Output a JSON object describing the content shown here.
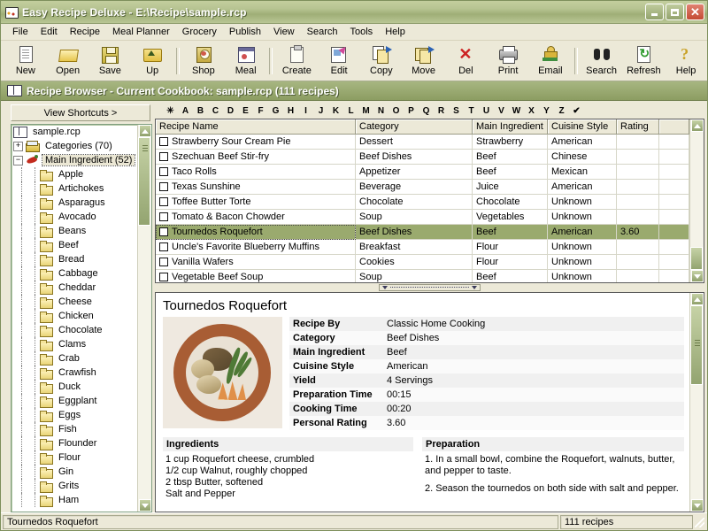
{
  "window": {
    "title": "Easy Recipe Deluxe - E:\\Recipe\\sample.rcp",
    "icon": "recipe-book-icon",
    "minimize": "_",
    "maximize": "□",
    "close": "✕"
  },
  "menu": {
    "items": [
      "File",
      "Edit",
      "Recipe",
      "Meal Planner",
      "Grocery",
      "Publish",
      "View",
      "Search",
      "Tools",
      "Help"
    ]
  },
  "toolbar": {
    "buttons": [
      {
        "label": "New",
        "icon": "new-page-icon"
      },
      {
        "label": "Open",
        "icon": "open-folder-icon"
      },
      {
        "label": "Save",
        "icon": "floppy-disk-icon"
      },
      {
        "label": "Up",
        "icon": "folder-up-icon"
      },
      {
        "label": "Shop",
        "icon": "shopping-icon"
      },
      {
        "label": "Meal",
        "icon": "meal-planner-icon"
      },
      {
        "label": "Create",
        "icon": "clipboard-new-icon"
      },
      {
        "label": "Edit",
        "icon": "edit-recipe-icon"
      },
      {
        "label": "Copy",
        "icon": "copy-icon"
      },
      {
        "label": "Move",
        "icon": "move-icon"
      },
      {
        "label": "Del",
        "icon": "delete-x-icon"
      },
      {
        "label": "Print",
        "icon": "printer-icon"
      },
      {
        "label": "Email",
        "icon": "email-icon"
      },
      {
        "label": "Search",
        "icon": "binoculars-icon"
      },
      {
        "label": "Refresh",
        "icon": "refresh-icon"
      },
      {
        "label": "Help",
        "icon": "question-mark-icon"
      }
    ]
  },
  "banner": {
    "icon": "open-book-icon",
    "text": "Recipe Browser - Current Cookbook: sample.rcp (111 recipes)"
  },
  "sidebar": {
    "shortcuts_button": "View Shortcuts >",
    "root": "sample.rcp",
    "nodes": [
      {
        "label": "Categories (70)",
        "expander": "+",
        "icon": "cards-icon",
        "level": 1,
        "selected": false
      },
      {
        "label": "Main Ingredient (52)",
        "expander": "−",
        "icon": "chili-icon",
        "level": 1,
        "selected": true
      }
    ],
    "leaves": [
      "Apple",
      "Artichokes",
      "Asparagus",
      "Avocado",
      "Beans",
      "Beef",
      "Bread",
      "Cabbage",
      "Cheddar",
      "Cheese",
      "Chicken",
      "Chocolate",
      "Clams",
      "Crab",
      "Crawfish",
      "Duck",
      "Eggplant",
      "Eggs",
      "Fish",
      "Flounder",
      "Flour",
      "Gin",
      "Grits",
      "Ham"
    ]
  },
  "alphabet_bar": {
    "items": [
      "✳",
      "A",
      "B",
      "C",
      "D",
      "E",
      "F",
      "G",
      "H",
      "I",
      "J",
      "K",
      "L",
      "M",
      "N",
      "O",
      "P",
      "Q",
      "R",
      "S",
      "T",
      "U",
      "V",
      "W",
      "X",
      "Y",
      "Z",
      "✔"
    ]
  },
  "grid": {
    "columns": [
      "Recipe Name",
      "Category",
      "Main Ingredient",
      "Cuisine Style",
      "Rating",
      ""
    ],
    "rows": [
      {
        "name": "Strawberry Sour Cream Pie",
        "category": "Dessert",
        "main": "Strawberry",
        "cuisine": "American",
        "rating": "",
        "selected": false
      },
      {
        "name": "Szechuan Beef Stir-fry",
        "category": "Beef Dishes",
        "main": "Beef",
        "cuisine": "Chinese",
        "rating": "",
        "selected": false
      },
      {
        "name": "Taco Rolls",
        "category": "Appetizer",
        "main": "Beef",
        "cuisine": "Mexican",
        "rating": "",
        "selected": false
      },
      {
        "name": "Texas Sunshine",
        "category": "Beverage",
        "main": "Juice",
        "cuisine": "American",
        "rating": "",
        "selected": false
      },
      {
        "name": "Toffee Butter Torte",
        "category": "Chocolate",
        "main": "Chocolate",
        "cuisine": "Unknown",
        "rating": "",
        "selected": false
      },
      {
        "name": "Tomato & Bacon Chowder",
        "category": "Soup",
        "main": "Vegetables",
        "cuisine": "Unknown",
        "rating": "",
        "selected": false
      },
      {
        "name": "Tournedos Roquefort",
        "category": "Beef Dishes",
        "main": "Beef",
        "cuisine": "American",
        "rating": "3.60",
        "selected": true
      },
      {
        "name": "Uncle's Favorite Blueberry Muffins",
        "category": "Breakfast",
        "main": "Flour",
        "cuisine": "Unknown",
        "rating": "",
        "selected": false
      },
      {
        "name": "Vanilla Wafers",
        "category": "Cookies",
        "main": "Flour",
        "cuisine": "Unknown",
        "rating": "",
        "selected": false
      },
      {
        "name": "Vegetable Beef Soup",
        "category": "Soup",
        "main": "Beef",
        "cuisine": "Unknown",
        "rating": "",
        "selected": false
      }
    ]
  },
  "detail": {
    "title": "Tournedos Roquefort",
    "photo_alt": "plated tournedos with green beans and carrot garnish",
    "fields": [
      {
        "key": "Recipe By",
        "value": "Classic Home Cooking"
      },
      {
        "key": "Category",
        "value": "Beef Dishes"
      },
      {
        "key": "Main Ingredient",
        "value": "Beef"
      },
      {
        "key": "Cuisine Style",
        "value": "American"
      },
      {
        "key": "Yield",
        "value": "4 Servings"
      },
      {
        "key": "Preparation Time",
        "value": "00:15"
      },
      {
        "key": "Cooking Time",
        "value": "00:20"
      },
      {
        "key": "Personal Rating",
        "value": "3.60"
      }
    ],
    "ingredients_heading": "Ingredients",
    "ingredients": [
      "1 cup Roquefort cheese, crumbled",
      "1/2 cup Walnut, roughly chopped",
      "2 tbsp Butter, softened",
      "Salt and Pepper"
    ],
    "preparation_heading": "Preparation",
    "preparation": [
      "1. In a small bowl, combine the Roquefort, walnuts, butter, and pepper to taste.",
      "2. Season the tournedos on both side with salt and pepper."
    ]
  },
  "statusbar": {
    "left": "Tournedos Roquefort",
    "right": "111 recipes"
  },
  "colors": {
    "title_bar": "#a9b883",
    "accent_green": "#8c9d62",
    "selection": "#9aaa6e",
    "close_red": "#c44b34",
    "window_face": "#ece9d8"
  }
}
